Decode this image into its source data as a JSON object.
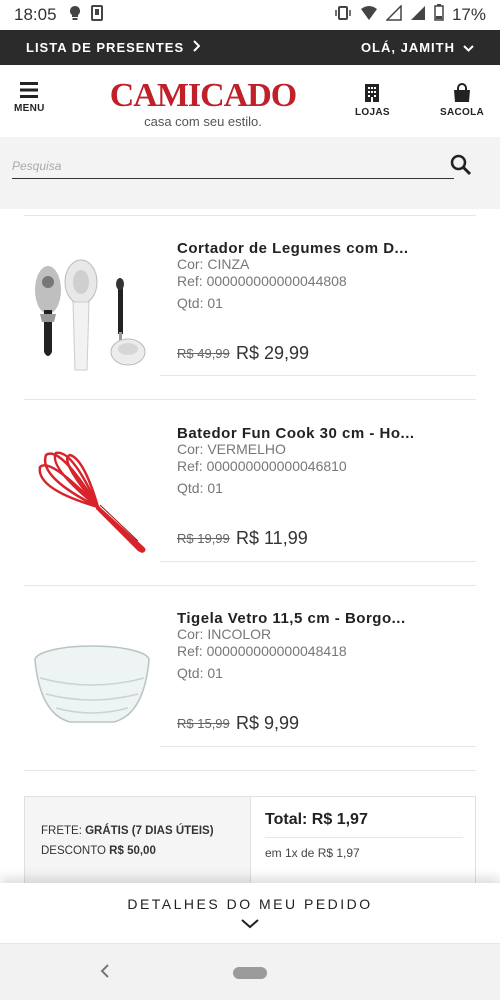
{
  "status_bar": {
    "time": "18:05",
    "battery": "17%"
  },
  "topbar": {
    "gift_list": "LISTA DE PRESENTES",
    "greeting": "OLÁ, JAMITH"
  },
  "header": {
    "menu_label": "MENU",
    "brand": "Camicado",
    "tagline": "casa com seu estilo.",
    "stores_label": "LOJAS",
    "bag_label": "SACOLA"
  },
  "search": {
    "placeholder": "Pesquisa"
  },
  "products": [
    {
      "name": "Cortador de Legumes com D...",
      "color": "Cor: CINZA",
      "ref": "Ref: 000000000000044808",
      "qty": "Qtd: 01",
      "old_price": "R$ 49,99",
      "new_price": "R$ 29,99",
      "image": "vegetable-cutter-icon"
    },
    {
      "name": "Batedor Fun Cook 30 cm - Ho...",
      "color": "Cor: VERMELHO",
      "ref": "Ref: 000000000000046810",
      "qty": "Qtd: 01",
      "old_price": "R$ 19,99",
      "new_price": "R$ 11,99",
      "image": "whisk-icon"
    },
    {
      "name": "Tigela Vetro 11,5 cm - Borgo...",
      "color": "Cor: INCOLOR",
      "ref": "Ref: 000000000000048418",
      "qty": "Qtd: 01",
      "old_price": "R$ 15,99",
      "new_price": "R$ 9,99",
      "image": "glass-bowl-icon"
    }
  ],
  "summary": {
    "shipping_label": "FRETE:",
    "shipping_value": "GRÁTIS (7 DIAS ÚTEIS)",
    "discount_label": "DESCONTO",
    "discount_value": "R$ 50,00",
    "total": "Total: R$ 1,97",
    "installments": "em 1x de R$ 1,97"
  },
  "drawer": {
    "title": "DETALHES DO MEU PEDIDO"
  },
  "colors": {
    "brand_red": "#c0202a",
    "topbar_bg": "#2b2b2b",
    "whisk_red": "#d8232a"
  }
}
